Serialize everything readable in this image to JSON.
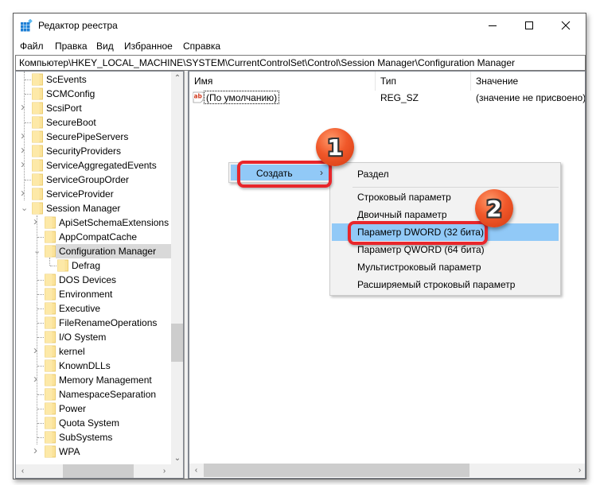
{
  "window": {
    "title": "Редактор реестра",
    "minimize_label": "Minimize",
    "maximize_label": "Maximize",
    "close_label": "Close"
  },
  "menubar": {
    "items": [
      "Файл",
      "Правка",
      "Вид",
      "Избранное",
      "Справка"
    ]
  },
  "address": {
    "path": "Компьютер\\HKEY_LOCAL_MACHINE\\SYSTEM\\CurrentControlSet\\Control\\Session Manager\\Configuration Manager"
  },
  "tree": {
    "items": [
      {
        "label": "ScEvents",
        "level": 0,
        "expander": "none"
      },
      {
        "label": "SCMConfig",
        "level": 0,
        "expander": "none"
      },
      {
        "label": "ScsiPort",
        "level": 0,
        "expander": "collapsed"
      },
      {
        "label": "SecureBoot",
        "level": 0,
        "expander": "none"
      },
      {
        "label": "SecurePipeServers",
        "level": 0,
        "expander": "collapsed"
      },
      {
        "label": "SecurityProviders",
        "level": 0,
        "expander": "collapsed"
      },
      {
        "label": "ServiceAggregatedEvents",
        "level": 0,
        "expander": "collapsed"
      },
      {
        "label": "ServiceGroupOrder",
        "level": 0,
        "expander": "none"
      },
      {
        "label": "ServiceProvider",
        "level": 0,
        "expander": "collapsed"
      },
      {
        "label": "Session Manager",
        "level": 0,
        "expander": "expanded"
      },
      {
        "label": "ApiSetSchemaExtensions",
        "level": 1,
        "expander": "collapsed"
      },
      {
        "label": "AppCompatCache",
        "level": 1,
        "expander": "none"
      },
      {
        "label": "Configuration Manager",
        "level": 1,
        "expander": "expanded",
        "selected": true
      },
      {
        "label": "Defrag",
        "level": 2,
        "expander": "none"
      },
      {
        "label": "DOS Devices",
        "level": 1,
        "expander": "none"
      },
      {
        "label": "Environment",
        "level": 1,
        "expander": "none"
      },
      {
        "label": "Executive",
        "level": 1,
        "expander": "none"
      },
      {
        "label": "FileRenameOperations",
        "level": 1,
        "expander": "none"
      },
      {
        "label": "I/O System",
        "level": 1,
        "expander": "none"
      },
      {
        "label": "kernel",
        "level": 1,
        "expander": "collapsed"
      },
      {
        "label": "KnownDLLs",
        "level": 1,
        "expander": "none"
      },
      {
        "label": "Memory Management",
        "level": 1,
        "expander": "collapsed"
      },
      {
        "label": "NamespaceSeparation",
        "level": 1,
        "expander": "none"
      },
      {
        "label": "Power",
        "level": 1,
        "expander": "none"
      },
      {
        "label": "Quota System",
        "level": 1,
        "expander": "none"
      },
      {
        "label": "SubSystems",
        "level": 1,
        "expander": "none"
      },
      {
        "label": "WPA",
        "level": 1,
        "expander": "collapsed"
      }
    ]
  },
  "list": {
    "columns": [
      "Имя",
      "Тип",
      "Значение"
    ],
    "rows": [
      {
        "name": "(По умолчанию)",
        "type": "REG_SZ",
        "value": "(значение не присвоено)",
        "icon": "string-value-icon"
      }
    ]
  },
  "context_menu": {
    "create_label": "Создать",
    "submenu": {
      "section": "Раздел",
      "items": [
        "Строковый параметр",
        "Двоичный параметр",
        "Параметр DWORD (32 бита)",
        "Параметр QWORD (64 бита)",
        "Мультистроковый параметр",
        "Расширяемый строковый параметр"
      ],
      "highlighted_index": 2
    }
  },
  "annotations": {
    "step1": "1",
    "step2": "2",
    "accent_color": "#e8262b"
  }
}
